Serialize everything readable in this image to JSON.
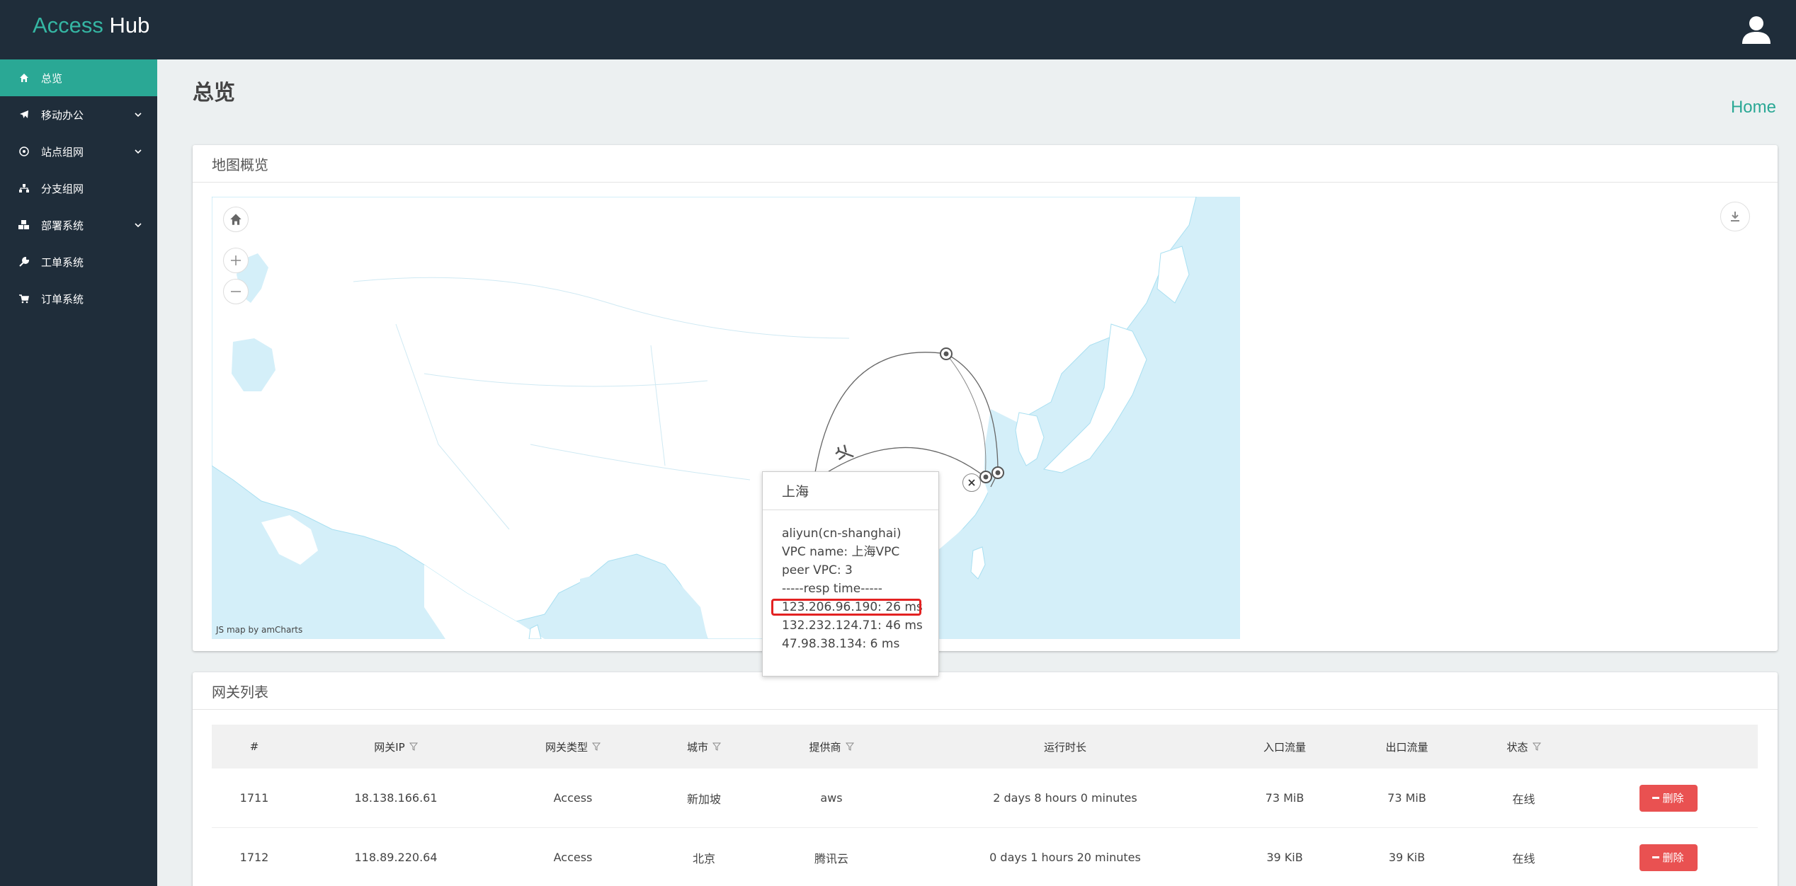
{
  "brand": {
    "part1": "Access",
    "part2": "Hub"
  },
  "sidebar": {
    "items": [
      {
        "label": "总览",
        "icon": "home-icon",
        "active": true,
        "expandable": false
      },
      {
        "label": "移动办公",
        "icon": "plane-icon",
        "active": false,
        "expandable": true
      },
      {
        "label": "站点组网",
        "icon": "network-icon",
        "active": false,
        "expandable": true
      },
      {
        "label": "分支组网",
        "icon": "sitemap-icon",
        "active": false,
        "expandable": false
      },
      {
        "label": "部署系统",
        "icon": "cubes-icon",
        "active": false,
        "expandable": true
      },
      {
        "label": "工单系统",
        "icon": "wrench-icon",
        "active": false,
        "expandable": false
      },
      {
        "label": "订单系统",
        "icon": "cart-icon",
        "active": false,
        "expandable": false
      }
    ]
  },
  "header": {
    "title": "总览",
    "breadcrumb": "Home"
  },
  "map_panel": {
    "title": "地图概览",
    "credit": "JS map by amCharts",
    "tooltip": {
      "title": "上海",
      "provider": "aliyun(cn-shanghai)",
      "vpc_name": "VPC name: 上海VPC",
      "peer_vpc": "peer VPC: 3",
      "resp_header": "-----resp time-----",
      "resp_times": [
        "123.206.96.190: 26 ms",
        "132.232.124.71: 46 ms",
        "47.98.38.134: 6 ms"
      ]
    }
  },
  "gateway_panel": {
    "title": "网关列表",
    "columns": [
      "#",
      "网关IP",
      "网关类型",
      "城市",
      "提供商",
      "运行时长",
      "入口流量",
      "出口流量",
      "状态",
      ""
    ],
    "rows": [
      {
        "id": "1711",
        "ip": "18.138.166.61",
        "type": "Access",
        "city": "新加坡",
        "provider": "aws",
        "uptime": "2 days 8 hours 0 minutes",
        "in": "73 MiB",
        "out": "73 MiB",
        "status": "在线",
        "action": "删除"
      },
      {
        "id": "1712",
        "ip": "118.89.220.64",
        "type": "Access",
        "city": "北京",
        "provider": "腾讯云",
        "uptime": "0 days 1 hours 20 minutes",
        "in": "39 KiB",
        "out": "39 KiB",
        "status": "在线",
        "action": "删除"
      }
    ]
  },
  "colors": {
    "accent": "#2aa895",
    "topbar": "#1f2d3a",
    "danger": "#e95151",
    "water": "#d4eff9"
  }
}
